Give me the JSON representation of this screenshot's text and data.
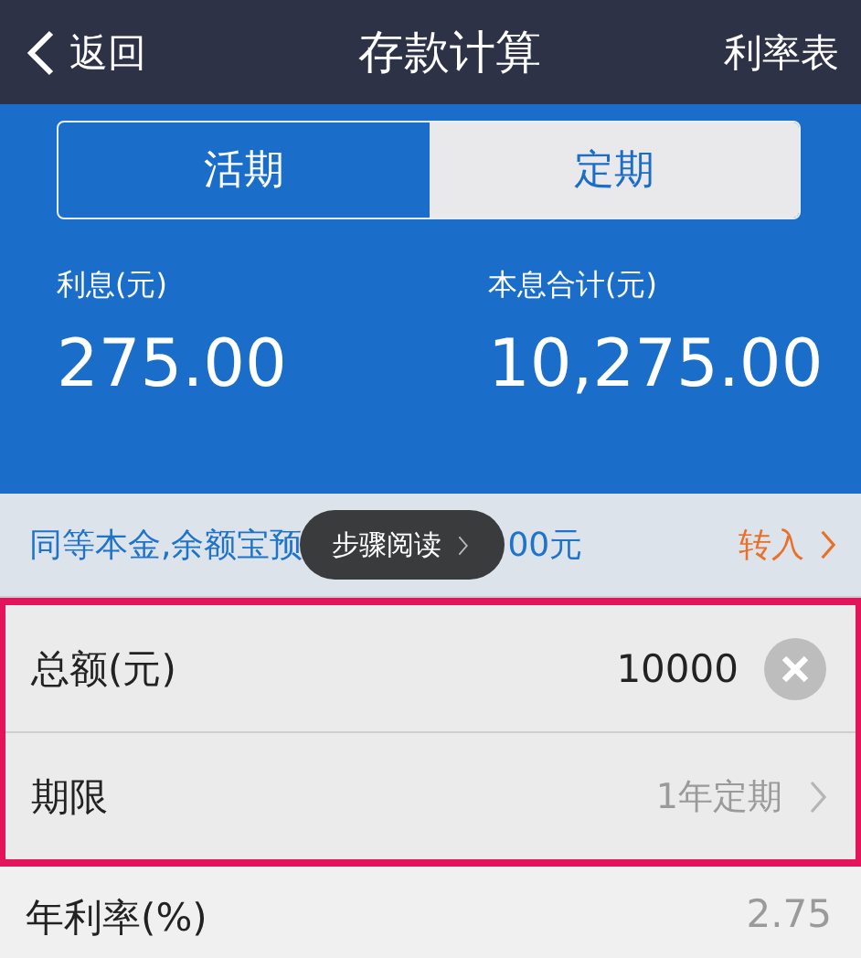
{
  "nav": {
    "back": "返回",
    "title": "存款计算",
    "action": "利率表"
  },
  "tabs": [
    {
      "label": "活期",
      "selected": false
    },
    {
      "label": "定期",
      "selected": true
    }
  ],
  "results": [
    {
      "label": "利息(元)",
      "value": "275.00"
    },
    {
      "label": "本息合计(元)",
      "value": "10,275.00"
    }
  ],
  "promo": {
    "text_before": "同等本金,余额宝预",
    "text_after": "00元",
    "link": "转入",
    "overlay": {
      "label": "步骤阅读"
    }
  },
  "highlighted_rows": [
    {
      "kind": "input",
      "label": "总额(元)",
      "value": "10000"
    },
    {
      "kind": "select",
      "label": "期限",
      "value": "1年定期"
    }
  ],
  "rows": [
    {
      "kind": "text",
      "label": "年利率(%)",
      "value": "2.75"
    }
  ]
}
